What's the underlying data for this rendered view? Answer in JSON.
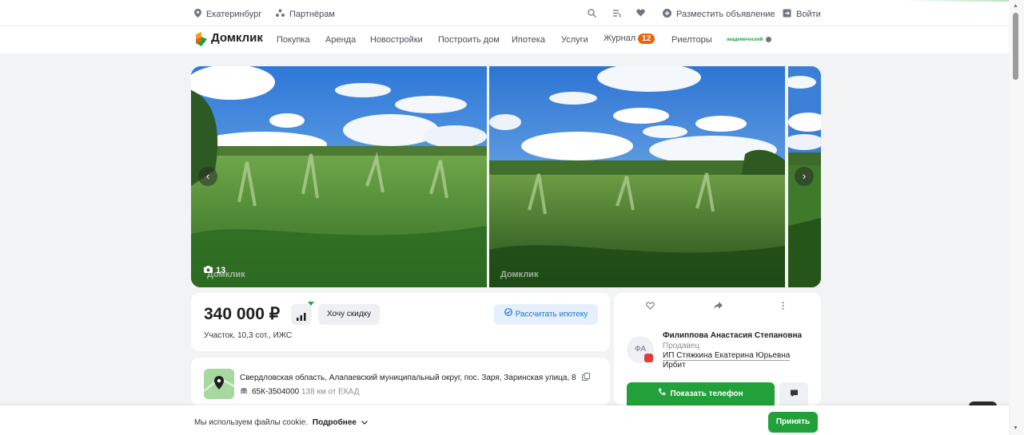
{
  "topbar": {
    "city": "Екатеринбург",
    "partners": "Партнёрам",
    "post_ad": "Разместить объявление",
    "login": "Войти"
  },
  "nav": {
    "logo": "Домклик",
    "items": [
      "Покупка",
      "Аренда",
      "Новостройки",
      "Построить дом",
      "Ипотека",
      "Услуги",
      "Журнал",
      "Риелторы"
    ],
    "journal_badge": "12",
    "academic_label": "академический"
  },
  "gallery": {
    "photo_count": "13",
    "watermark": "Домклик"
  },
  "listing": {
    "price": "340 000 ₽",
    "discount_label": "Хочу скидку",
    "mortgage_label": "Рассчитать ипотеку",
    "subtitle": "Участок, 10,3 сот., ИЖС",
    "address": "Свердловская область, Алапаевский муниципальный округ, пос. Заря, Заринская улица, 8",
    "highway": "65К-3504000",
    "distance": "138 км от ЕКАД"
  },
  "seller": {
    "initials": "ФА",
    "name": "Филиппова Анастасия Степановна",
    "role": "Продавец",
    "company": "ИП Стяжкина Екатерина Юрьевна",
    "city": "Ирбит",
    "phone_label": "Показать телефон"
  },
  "cookie": {
    "text": "Мы используем файлы cookie.",
    "more": "Подробнее",
    "accept": "Принять"
  },
  "colors": {
    "brand_green": "#22a03a",
    "accent_orange": "#e8650a",
    "link_blue": "#1a6fd1"
  }
}
